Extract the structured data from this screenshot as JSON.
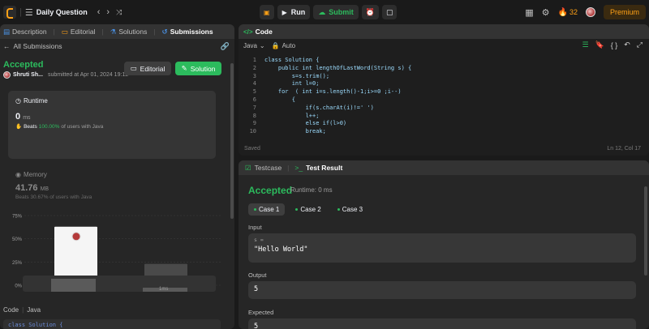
{
  "topnav": {
    "problem_list_label": "Daily Question",
    "run_label": "Run",
    "submit_label": "Submit",
    "streak_count": "32",
    "premium_label": "Premium"
  },
  "left_tabs": [
    {
      "label": "Description",
      "icon": "description-icon",
      "color": "#4a90e2"
    },
    {
      "label": "Editorial",
      "icon": "book-icon",
      "color": "#ffa116"
    },
    {
      "label": "Solutions",
      "icon": "flask-icon",
      "color": "#4a90e2"
    },
    {
      "label": "Submissions",
      "icon": "history-icon",
      "color": "#4a90e2"
    }
  ],
  "submission": {
    "back_label": "All Submissions",
    "status": "Accepted",
    "user": "Shruti Sh...",
    "submitted_text": "submitted at Apr 01, 2024 19:12",
    "editorial_label": "Editorial",
    "solution_label": "Solution"
  },
  "runtime": {
    "title": "Runtime",
    "value": "0",
    "unit": "ms",
    "beats_prefix": "Beats",
    "beats_value": "100.00%",
    "beats_suffix": "of users with Java"
  },
  "memory": {
    "title": "Memory",
    "value": "41.76",
    "unit": "MB",
    "beats_text": "Beats 30.67% of users with Java"
  },
  "chart_data": {
    "type": "bar",
    "yticks": [
      "75%",
      "50%",
      "25%",
      "0%"
    ],
    "ylim": [
      0,
      75
    ],
    "bars": [
      {
        "label": "",
        "value": 63,
        "highlight": true
      },
      {
        "label": "1ms",
        "value": 23,
        "highlight": false
      }
    ],
    "mini_labels": [
      "1ms"
    ]
  },
  "code_footer": {
    "code_label": "Code",
    "lang_label": "Java",
    "snippet": "class Solution {"
  },
  "editor": {
    "title": "Code",
    "language": "Java",
    "auto_label": "Auto",
    "saved_label": "Saved",
    "cursor": "Ln 12, Col 17",
    "lines": [
      {
        "n": "1",
        "code": "class Solution {"
      },
      {
        "n": "2",
        "code": "    public int lengthOfLastWord(String s) {"
      },
      {
        "n": "3",
        "code": "        s=s.trim();"
      },
      {
        "n": "4",
        "code": "        int l=0;"
      },
      {
        "n": "5",
        "code": "    for  ( int i=s.length()-1;i>=0 ;i--)"
      },
      {
        "n": "6",
        "code": "        {"
      },
      {
        "n": "7",
        "code": "            if(s.charAt(i)!=' ')"
      },
      {
        "n": "8",
        "code": "            l++;"
      },
      {
        "n": "9",
        "code": "            else if(l>0)"
      },
      {
        "n": "10",
        "code": "            break;"
      }
    ]
  },
  "testpanel": {
    "testcase_label": "Testcase",
    "result_label": "Test Result",
    "status": "Accepted",
    "runtime_text": "Runtime: 0 ms",
    "cases": [
      "Case 1",
      "Case 2",
      "Case 3"
    ],
    "input_label": "Input",
    "input_var": "s =",
    "input_value": "\"Hello World\"",
    "output_label": "Output",
    "output_value": "5",
    "expected_label": "Expected",
    "expected_value": "5"
  }
}
